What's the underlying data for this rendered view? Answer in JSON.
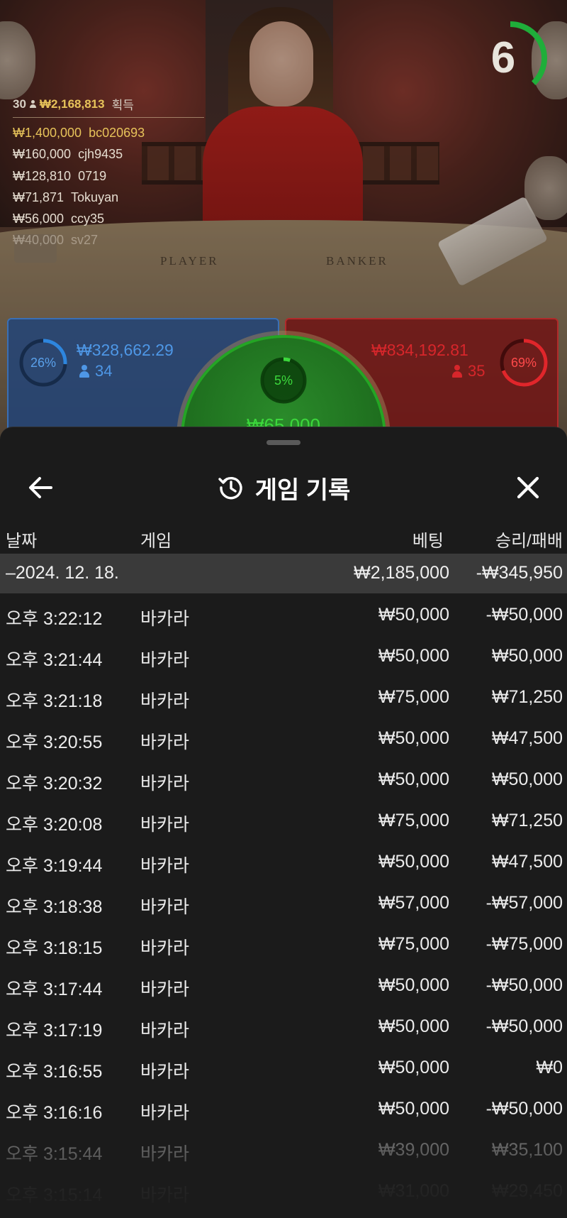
{
  "winners": {
    "count": "30",
    "total": "₩2,168,813",
    "total_suffix": "획득",
    "entries": [
      {
        "amount": "₩1,400,000",
        "name": "bc020693"
      },
      {
        "amount": "₩160,000",
        "name": "cjh9435"
      },
      {
        "amount": "₩128,810",
        "name": "0719"
      },
      {
        "amount": "₩71,871",
        "name": "Tokuyan"
      },
      {
        "amount": "₩56,000",
        "name": "ccy35"
      },
      {
        "amount": "₩40,000",
        "name": "sv27"
      }
    ]
  },
  "table_labels": {
    "player": "PLAYER",
    "banker": "BANKER"
  },
  "timer": {
    "value": "6",
    "progress": 0.38,
    "color": "#1fae3a"
  },
  "bets": {
    "player": {
      "percent": "26%",
      "percent_value": 0.26,
      "amount": "₩328,662.29",
      "count": "34",
      "color": "#2e86de"
    },
    "banker": {
      "percent": "69%",
      "percent_value": 0.69,
      "amount": "₩834,192.81",
      "count": "35",
      "color": "#e0262b"
    },
    "tie": {
      "percent": "5%",
      "percent_value": 0.05,
      "amount": "₩65,000",
      "color": "#3cd83c"
    }
  },
  "sheet": {
    "title": "게임 기록",
    "columns": {
      "date": "날짜",
      "game": "게임",
      "bet": "베팅",
      "win_loss": "승리/패배"
    },
    "group": {
      "label": "–2024. 12. 18.",
      "bet": "₩2,185,000",
      "win_loss": "-₩345,950"
    },
    "rows": [
      {
        "time": "오후 3:22:12",
        "game": "바카라",
        "bet": "₩50,000",
        "win_loss": "-₩50,000"
      },
      {
        "time": "오후 3:21:44",
        "game": "바카라",
        "bet": "₩50,000",
        "win_loss": "₩50,000"
      },
      {
        "time": "오후 3:21:18",
        "game": "바카라",
        "bet": "₩75,000",
        "win_loss": "₩71,250"
      },
      {
        "time": "오후 3:20:55",
        "game": "바카라",
        "bet": "₩50,000",
        "win_loss": "₩47,500"
      },
      {
        "time": "오후 3:20:32",
        "game": "바카라",
        "bet": "₩50,000",
        "win_loss": "₩50,000"
      },
      {
        "time": "오후 3:20:08",
        "game": "바카라",
        "bet": "₩75,000",
        "win_loss": "₩71,250"
      },
      {
        "time": "오후 3:19:44",
        "game": "바카라",
        "bet": "₩50,000",
        "win_loss": "₩47,500"
      },
      {
        "time": "오후 3:18:38",
        "game": "바카라",
        "bet": "₩57,000",
        "win_loss": "-₩57,000"
      },
      {
        "time": "오후 3:18:15",
        "game": "바카라",
        "bet": "₩75,000",
        "win_loss": "-₩75,000"
      },
      {
        "time": "오후 3:17:44",
        "game": "바카라",
        "bet": "₩50,000",
        "win_loss": "-₩50,000"
      },
      {
        "time": "오후 3:17:19",
        "game": "바카라",
        "bet": "₩50,000",
        "win_loss": "-₩50,000"
      },
      {
        "time": "오후 3:16:55",
        "game": "바카라",
        "bet": "₩50,000",
        "win_loss": "₩0"
      },
      {
        "time": "오후 3:16:16",
        "game": "바카라",
        "bet": "₩50,000",
        "win_loss": "-₩50,000"
      },
      {
        "time": "오후 3:15:44",
        "game": "바카라",
        "bet": "₩39,000",
        "win_loss": "₩35,100"
      },
      {
        "time": "오후 3:15:14",
        "game": "바카라",
        "bet": "₩31,000",
        "win_loss": "₩29,450"
      }
    ]
  },
  "icons": {
    "back": "arrow-left-icon",
    "history": "history-icon",
    "close": "close-icon"
  }
}
